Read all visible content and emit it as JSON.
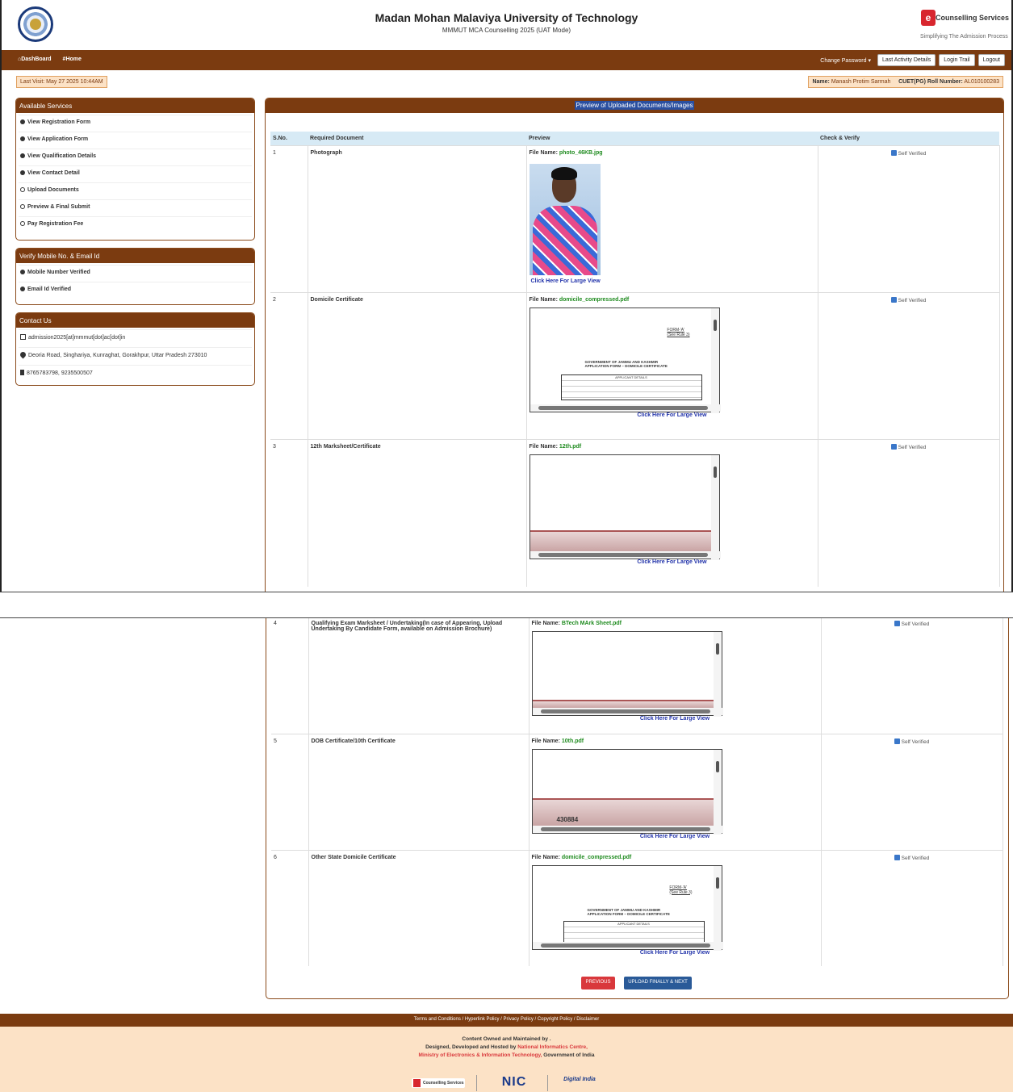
{
  "header": {
    "university": "Madan Mohan Malaviya University of Technology",
    "subtitle": "MMMUT MCA Counselling 2025 (UAT Mode)",
    "brand_mark": "e",
    "brand_title": "Counselling Services",
    "brand_tagline": "Simplifying The Admission Process"
  },
  "nav": {
    "dashboard": "DashBoard",
    "home": "Home",
    "change_password": "Change Password",
    "last_activity": "Last Activity Details",
    "login_trail": "Login Trail",
    "logout": "Logout"
  },
  "info": {
    "last_visit": "Last Visit: May 27 2025 10:44AM",
    "name_label": "Name:",
    "name_value": "Manash Protim Sarmah",
    "roll_label": "CUET(PG) Roll Number:",
    "roll_value": "AL010100283"
  },
  "services": {
    "title": "Available Services",
    "items": [
      {
        "label": "View Registration Form"
      },
      {
        "label": "View Application Form"
      },
      {
        "label": "View Qualification Details"
      },
      {
        "label": "View Contact Detail"
      },
      {
        "label": "Upload Documents"
      },
      {
        "label": "Preview & Final Submit"
      },
      {
        "label": "Pay Registration Fee"
      }
    ]
  },
  "verify": {
    "title": "Verify Mobile No. & Email Id",
    "items": [
      {
        "label": "Mobile Number Verified"
      },
      {
        "label": "Email Id Verified"
      }
    ]
  },
  "contact": {
    "title": "Contact Us",
    "email": "admission2025[at]mmmut[dot]ac[dot]in",
    "address": "Deoria Road, Singhariya, Kunraghat, Gorakhpur, Uttar Pradesh 273010",
    "phone": "8765783798, 9235500507"
  },
  "preview": {
    "title": "Preview of Uploaded Documents/Images",
    "columns": [
      "S.No.",
      "Required Document",
      "Preview",
      "Check & Verify"
    ],
    "file_label": "File Name:",
    "large_view": "Click Here For Large View",
    "self_verified": "Self Verified",
    "rows": [
      {
        "sno": "1",
        "doc": "Photograph",
        "file": "photo_46KB.jpg"
      },
      {
        "sno": "2",
        "doc": "Domicile Certificate",
        "file": "domicile_compressed.pdf"
      },
      {
        "sno": "3",
        "doc": "12th Marksheet/Certificate",
        "file": "12th.pdf"
      },
      {
        "sno": "4",
        "doc": "Qualifying Exam Marksheet / Undertaking(In case of Appearing, Upload Undertaking By Candidate Form, available on Admission Brochure)",
        "file": "BTech MArk Sheet.pdf"
      },
      {
        "sno": "5",
        "doc": "DOB Certificate/10th Certificate",
        "file": "10th.pdf"
      },
      {
        "sno": "6",
        "doc": "Other State Domicile Certificate",
        "file": "domicile_compressed.pdf"
      }
    ],
    "form_text": {
      "form_a": "FORM-'A'",
      "see_rule": "(See Rule 3)",
      "govt": "GOVERNMENT OF JAMMU AND KASHMIR",
      "app_form": "APPLICATION FORM – DOMICILE CERTIFICATE",
      "applicant": "APPLICANT DETAILS",
      "roll": "430884"
    }
  },
  "actions": {
    "previous": "PREVIOUS",
    "next": "UPLOAD FINALLY & NEXT"
  },
  "footer": {
    "links": "Terms and Conditions  /  Hyperlink Policy  /  Privacy Policy  /  Copyright Policy  /  Disclaimer",
    "owned": "Content Owned and Maintained by .",
    "designed_prefix": "Designed, Developed and Hosted by",
    "nic": "National Informatics Centre,",
    "ministry": "Ministry of Electronics & Information Technology,",
    "goi": "Government of India",
    "logo_cs": "Counselling Services",
    "logo_nic": "NIC",
    "logo_di": "Digital India"
  }
}
